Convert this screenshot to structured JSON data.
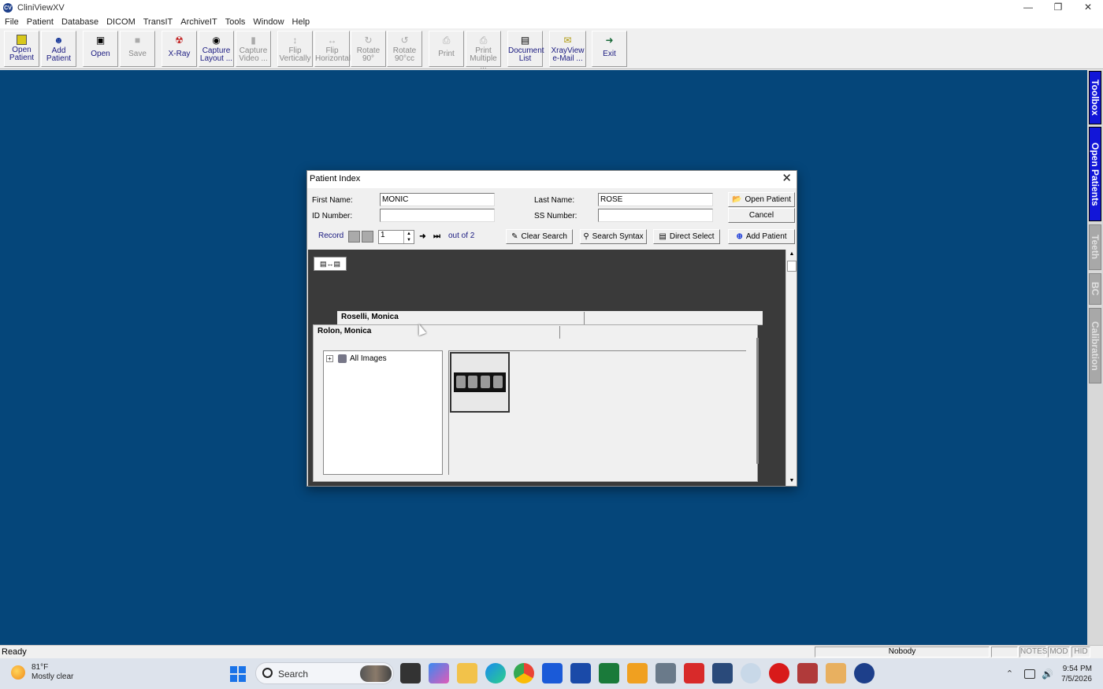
{
  "window": {
    "title": "CliniViewXV",
    "icon_text": "CV"
  },
  "menu": [
    "File",
    "Patient",
    "Database",
    "DICOM",
    "TransIT",
    "ArchiveIT",
    "Tools",
    "Window",
    "Help"
  ],
  "toolbar": [
    {
      "label": "Open Patient",
      "icon": "folder-icon",
      "enabled": true
    },
    {
      "label": "Add Patient",
      "icon": "add-user-icon",
      "enabled": true
    },
    {
      "label": "Open",
      "icon": "open-icon",
      "enabled": true
    },
    {
      "label": "Save",
      "icon": "save-icon",
      "enabled": false
    },
    {
      "label": "X-Ray",
      "icon": "xray-icon",
      "enabled": true
    },
    {
      "label": "Capture Layout ...",
      "icon": "capture-icon",
      "enabled": true
    },
    {
      "label": "Capture Video ...",
      "icon": "video-icon",
      "enabled": false
    },
    {
      "label": "Flip Vertically",
      "icon": "flip-vertical-icon",
      "enabled": false
    },
    {
      "label": "Flip Horizontally",
      "icon": "flip-horizontal-icon",
      "enabled": false
    },
    {
      "label": "Rotate 90°",
      "icon": "rotate-icon",
      "enabled": false
    },
    {
      "label": "Rotate 90°cc",
      "icon": "rotate-ccw-icon",
      "enabled": false
    },
    {
      "label": "Print",
      "icon": "print-icon",
      "enabled": false
    },
    {
      "label": "Print Multiple ...",
      "icon": "print-multiple-icon",
      "enabled": false
    },
    {
      "label": "Document List",
      "icon": "document-icon",
      "enabled": true
    },
    {
      "label": "XrayView e-Mail ...",
      "icon": "email-icon",
      "enabled": true
    },
    {
      "label": "Exit",
      "icon": "exit-icon",
      "enabled": true
    }
  ],
  "side_tabs": [
    {
      "label": "Toolbox",
      "active": true
    },
    {
      "label": "Open Patients",
      "active": true
    },
    {
      "label": "Teeth",
      "active": false
    },
    {
      "label": "BC",
      "active": false
    },
    {
      "label": "Calibration",
      "active": false
    }
  ],
  "dialog": {
    "title": "Patient Index",
    "first_name_label": "First Name:",
    "first_name_value": "MONIC",
    "last_name_label": "Last Name:",
    "last_name_value": "ROSE",
    "id_label": "ID Number:",
    "id_value": "",
    "ss_label": "SS Number:",
    "ss_value": "",
    "open_patient": "Open Patient",
    "cancel": "Cancel",
    "record_label": "Record",
    "record_value": "1",
    "out_of": "out of 2",
    "clear_search": "Clear Search",
    "search_syntax": "Search Syntax",
    "direct_select": "Direct Select",
    "add_patient": "Add Patient",
    "cards": [
      "Roselli, Monica",
      "Rolon, Monica"
    ],
    "tree_label": "All Images"
  },
  "status": {
    "ready": "Ready",
    "user": "Nobody",
    "notes": "NOTES",
    "mod": "MOD",
    "hid": "HID"
  },
  "taskbar": {
    "temp": "81°F",
    "weather": "Mostly clear",
    "search": "Search",
    "time": "9:54 PM",
    "date": "7/5/2026"
  },
  "colors": {
    "workspace": "#05467a",
    "side_tab_active": "#1216d8",
    "taskbar": "#dde3ec"
  }
}
